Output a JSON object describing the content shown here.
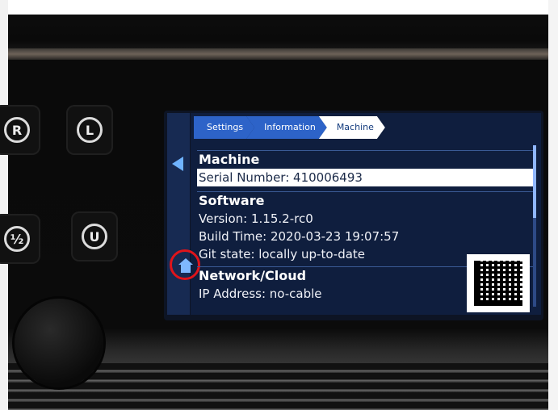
{
  "hardware": {
    "buttons": [
      {
        "name": "hw-button-r",
        "glyph": "R"
      },
      {
        "name": "hw-button-l",
        "glyph": "L"
      },
      {
        "name": "hw-button-half",
        "glyph": "½"
      },
      {
        "name": "hw-button-u",
        "glyph": "U"
      }
    ]
  },
  "breadcrumb": {
    "items": [
      {
        "label": "Settings"
      },
      {
        "label": "Information"
      },
      {
        "label": "Machine"
      }
    ]
  },
  "icons": {
    "back": "back-arrow-icon",
    "home": "home-icon",
    "qr": "qr-code-icon"
  },
  "sections": {
    "machine": {
      "title": "Machine",
      "serial": "Serial Number: 410006493"
    },
    "software": {
      "title": "Software",
      "version": "Version: 1.15.2-rc0",
      "build_time": "Build Time: 2020-03-23 19:07:57",
      "git_state": "Git state: locally up-to-date"
    },
    "network": {
      "title": "Network/Cloud",
      "ip": "IP Address: no-cable"
    }
  },
  "colors": {
    "screen_bg": "#0f1e3e",
    "crumb_bg": "#2d63c8",
    "crumb_active_bg": "#ffffff",
    "highlight_ring": "#e0141a"
  }
}
